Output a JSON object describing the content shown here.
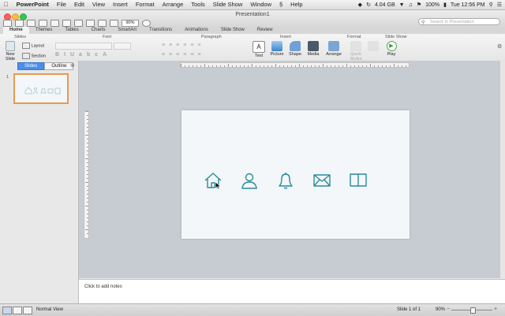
{
  "menubar": {
    "app_name": "PowerPoint",
    "items": [
      "File",
      "Edit",
      "View",
      "Insert",
      "Format",
      "Arrange",
      "Tools",
      "Slide Show",
      "Window",
      "Help"
    ],
    "disk_free": "4.04 GB",
    "battery": "100%",
    "clock": "Tue 12:56 PM"
  },
  "titlebar": {
    "doc_title": "Presentation1",
    "zoom": "90%",
    "search_placeholder": "Search in Presentation"
  },
  "ribbon_tabs": [
    "Home",
    "Themes",
    "Tables",
    "Charts",
    "SmartArt",
    "Transitions",
    "Animations",
    "Slide Show",
    "Review"
  ],
  "ribbon_active_tab": "Home",
  "ribbon": {
    "group_slides": "Slides",
    "group_font": "Font",
    "group_paragraph": "Paragraph",
    "group_insert": "Insert",
    "group_format": "Format",
    "group_slideshow": "Slide Show",
    "new_slide": "New Slide",
    "layout": "Layout",
    "section": "Section",
    "text": "Text",
    "picture": "Picture",
    "shape": "Shape",
    "media": "Media",
    "arrange": "Arrange",
    "quick_styles": "Quick Styles",
    "play": "Play"
  },
  "left_pane": {
    "tabs": [
      "Slides",
      "Outline"
    ],
    "active_tab": "Slides",
    "slide_number": "1"
  },
  "slide": {
    "icons": [
      "home-icon",
      "user-icon",
      "bell-icon",
      "mail-icon",
      "book-icon"
    ],
    "icon_color": "#2a8b9a"
  },
  "notes": {
    "placeholder": "Click to add notes"
  },
  "status": {
    "view_name": "Normal View",
    "slide_count": "Slide 1 of 1",
    "zoom": "90%"
  },
  "colors": {
    "accent_blue": "#4b8ee8",
    "thumb_selection": "#e79a4f",
    "slide_bg": "#f3f7f9",
    "canvas_bg": "#c7ccd3"
  }
}
